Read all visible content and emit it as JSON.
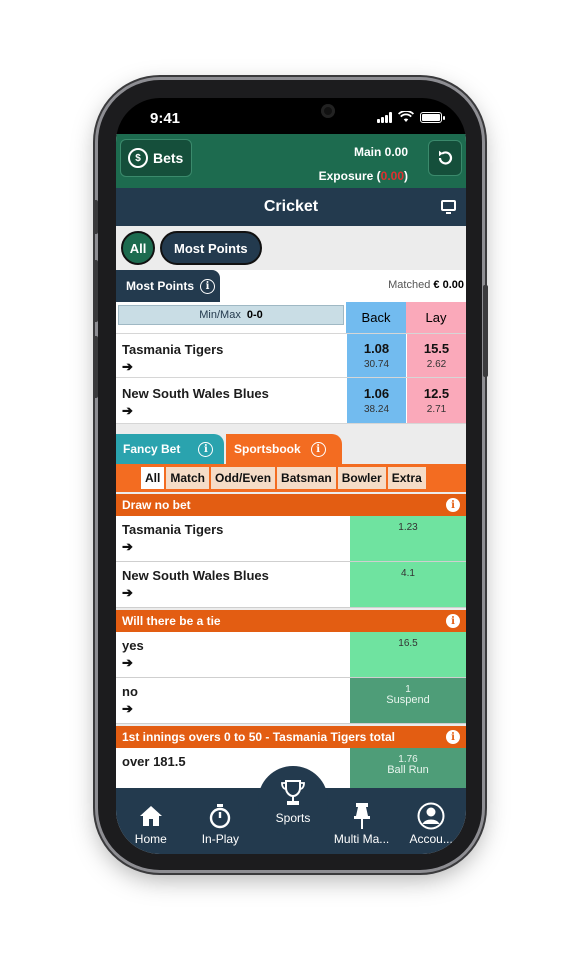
{
  "status_bar": {
    "time": "9:41"
  },
  "header": {
    "bets_label": "Bets",
    "main_label": "Main",
    "main_value": "0.00",
    "exposure_label": "Exposure",
    "exposure_value": "0.00",
    "exposure_open": "(",
    "exposure_close": ")"
  },
  "sport": {
    "title": "Cricket"
  },
  "filters": [
    {
      "label": "All",
      "active": true
    },
    {
      "label": "Most Points",
      "active": false
    }
  ],
  "market": {
    "tab_label": "Most Points",
    "matched_label": "Matched",
    "matched_value": "€ 0.00",
    "minmax_label": "Min/Max",
    "minmax_value": "0-0",
    "back_label": "Back",
    "lay_label": "Lay",
    "runners": [
      {
        "name": "Tasmania Tigers",
        "back_price": "1.08",
        "back_size": "30.74",
        "lay_price": "15.5",
        "lay_size": "2.62"
      },
      {
        "name": "New South Wales Blues",
        "back_price": "1.06",
        "back_size": "38.24",
        "lay_price": "12.5",
        "lay_size": "2.71"
      }
    ]
  },
  "tabs": {
    "fancy": "Fancy Bet",
    "sportsbook": "Sportsbook"
  },
  "subtabs": [
    "All",
    "Match",
    "Odd/Even",
    "Batsman",
    "Bowler",
    "Extra"
  ],
  "sections": [
    {
      "title": "Draw no bet",
      "rows": [
        {
          "name": "Tasmania Tigers",
          "odd": "1.23",
          "suspended": false
        },
        {
          "name": "New South Wales Blues",
          "odd": "4.1",
          "suspended": false
        }
      ]
    },
    {
      "title": "Will there be a tie",
      "rows": [
        {
          "name": "yes",
          "odd": "16.5",
          "suspended": false
        },
        {
          "name": "no",
          "odd": "1",
          "suspended": true,
          "status": "Suspend"
        }
      ]
    },
    {
      "title": "1st innings overs 0 to 50 - Tasmania Tigers total",
      "rows": [
        {
          "name": "over 181.5",
          "odd": "1.76",
          "suspended": true,
          "status": "Ball Run"
        }
      ]
    }
  ],
  "nav": {
    "home": "Home",
    "inplay": "In-Play",
    "sports": "Sports",
    "multi": "Multi Ma...",
    "account": "Accou..."
  },
  "colors": {
    "brand": "#1d6b4f",
    "navy": "#233a4e",
    "back": "#72bbef",
    "lay": "#faa9ba",
    "orange": "#f36c21",
    "teal": "#2aa3ae"
  }
}
